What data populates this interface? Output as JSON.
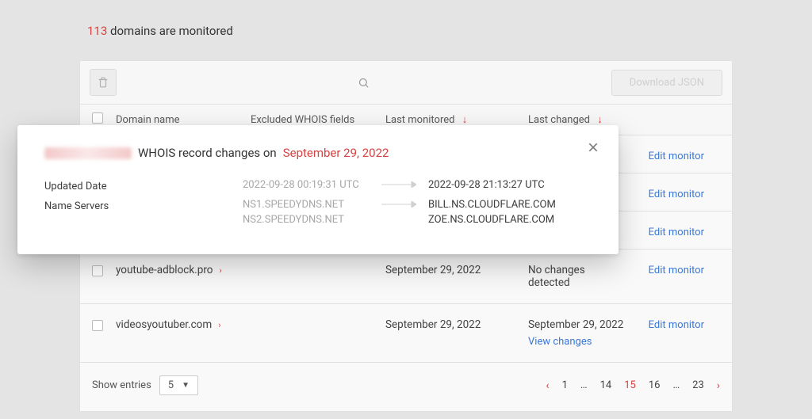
{
  "header": {
    "count": "113",
    "suffix": "domains are monitored"
  },
  "toolbar": {
    "download_label": "Download JSON"
  },
  "columns": {
    "domain": "Domain name",
    "excluded": "Excluded WHOIS fields",
    "last_monitored": "Last monitored",
    "last_changed": "Last changed"
  },
  "rows": [
    {
      "domain": "youtube-adblock.pro",
      "last_monitored": "September 29, 2022",
      "last_changed": "No changes detected",
      "view_changes": false,
      "edit_label": "Edit monitor"
    },
    {
      "domain": "videosyoutuber.com",
      "last_monitored": "September 29, 2022",
      "last_changed": "September 29, 2022",
      "view_changes_label": "View changes",
      "view_changes": true,
      "edit_label": "Edit monitor"
    }
  ],
  "obscured_edit_labels": [
    "Edit monitor",
    "Edit monitor",
    "Edit monitor"
  ],
  "pagination": {
    "show_entries_label": "Show entries",
    "page_size": "5",
    "pages": [
      "1",
      "…",
      "14",
      "15",
      "16",
      "…",
      "23"
    ],
    "active_page": "15"
  },
  "modal": {
    "title_prefix": "WHOIS record changes on",
    "title_date": "September 29, 2022",
    "changes": [
      {
        "label": "Updated Date",
        "old": [
          "2022-09-28 00:19:31 UTC"
        ],
        "new": [
          "2022-09-28 21:13:27 UTC"
        ]
      },
      {
        "label": "Name Servers",
        "old": [
          "NS1.SPEEDYDNS.NET",
          "NS2.SPEEDYDNS.NET"
        ],
        "new": [
          "BILL.NS.CLOUDFLARE.COM",
          "ZOE.NS.CLOUDFLARE.COM"
        ]
      }
    ]
  }
}
